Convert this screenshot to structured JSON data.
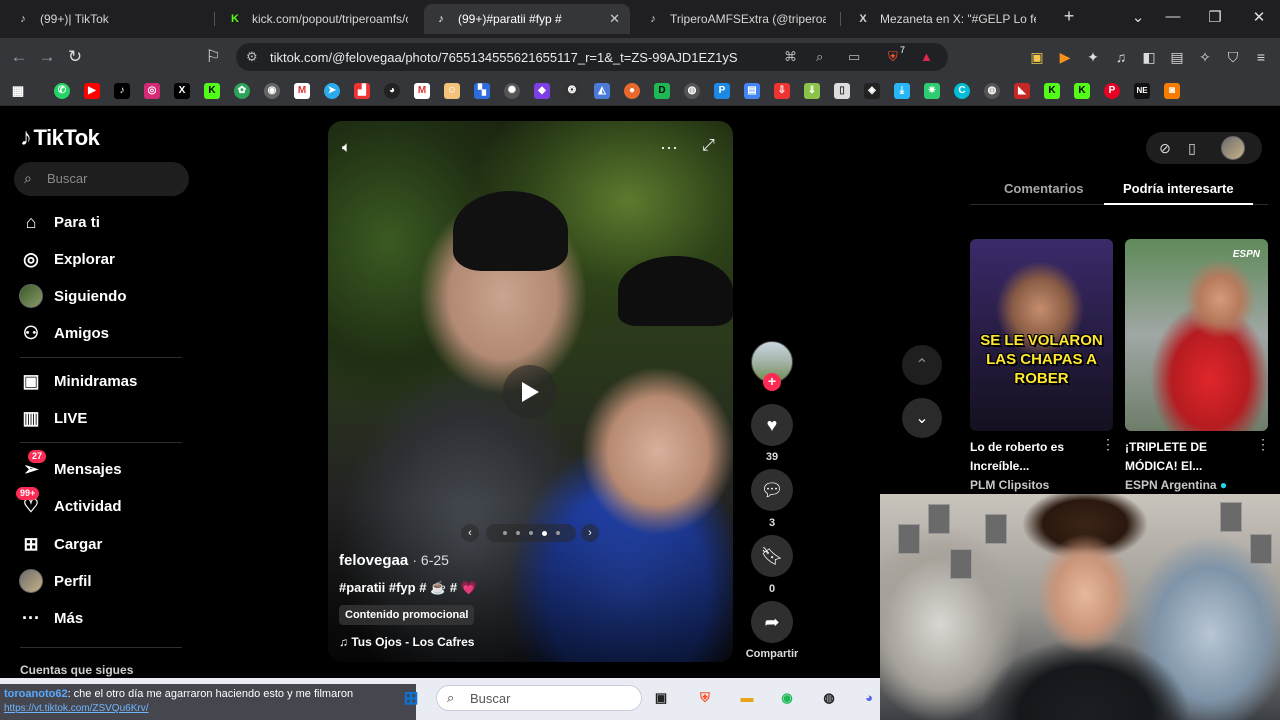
{
  "browser": {
    "tabs": [
      {
        "title": "(99+)| TikTok",
        "favicon": "tiktok-favicon"
      },
      {
        "title": "kick.com/popout/triperoamfs/ch",
        "favicon": "kick-favicon"
      },
      {
        "title": "(99+)#paratii #fyp #",
        "favicon": "tiktok-favicon",
        "active": true
      },
      {
        "title": "TriperoAMFSExtra (@triperoamfs",
        "favicon": "tiktok-favicon"
      },
      {
        "title": "Mezaneta en X: \"#GELP Lo feliz q",
        "favicon": "x-favicon"
      }
    ],
    "new_tab": "+",
    "url": "tiktok.com/@felovegaa/photo/7655134555621655117_r=1&_t=ZS-99AJD1EZ1yS",
    "extension_badge": "7"
  },
  "tiktok": {
    "logo": "TikTok",
    "search_placeholder": "Buscar",
    "nav": [
      {
        "label": "Para ti",
        "icon": "home-icon"
      },
      {
        "label": "Explorar",
        "icon": "compass-icon"
      },
      {
        "label": "Siguiendo",
        "icon": "following-avatar-icon"
      },
      {
        "label": "Amigos",
        "icon": "friends-icon"
      },
      {
        "label": "Minidramas",
        "icon": "film-icon"
      },
      {
        "label": "LIVE",
        "icon": "live-tv-icon"
      },
      {
        "label": "Mensajes",
        "icon": "messages-icon",
        "badge": "27"
      },
      {
        "label": "Actividad",
        "icon": "activity-icon",
        "badge": "99+"
      },
      {
        "label": "Cargar",
        "icon": "upload-icon"
      },
      {
        "label": "Perfil",
        "icon": "profile-avatar-icon"
      },
      {
        "label": "Más",
        "icon": "more-icon"
      }
    ],
    "following_section": "Cuentas que sigues",
    "post": {
      "author": "felovegaa",
      "date": "· 6-25",
      "caption": "#paratii #fyp # ☕ # 💗",
      "promo": "Contenido promocional",
      "music": "Tus Ojos - Los Cafres",
      "carousel_total": 5,
      "carousel_active": 4
    },
    "actions": {
      "likes": "39",
      "comments": "3",
      "saves": "0",
      "share": "Compartir"
    },
    "right_tabs": {
      "comments": "Comentarios",
      "suggested": "Podría interesarte"
    },
    "suggested": [
      {
        "overlay": "SE LE VOLARON LAS CHAPAS A ROBER",
        "title": "Lo de roberto es Increíble...",
        "author": "PLM Clipsitos"
      },
      {
        "overlay": "ESPN",
        "title": "¡TRIPLETE DE MÓDICA! El...",
        "author": "ESPN Argentina"
      }
    ],
    "accent": "#fe2c55"
  },
  "stream": {
    "chat_user": "toroanoto62",
    "chat_text": ": che el otro día me agarraron haciendo esto y me filmaron",
    "chat_link": "https://vt.tiktok.com/ZSVQu6Krv/",
    "taskbar_search": "Buscar"
  }
}
